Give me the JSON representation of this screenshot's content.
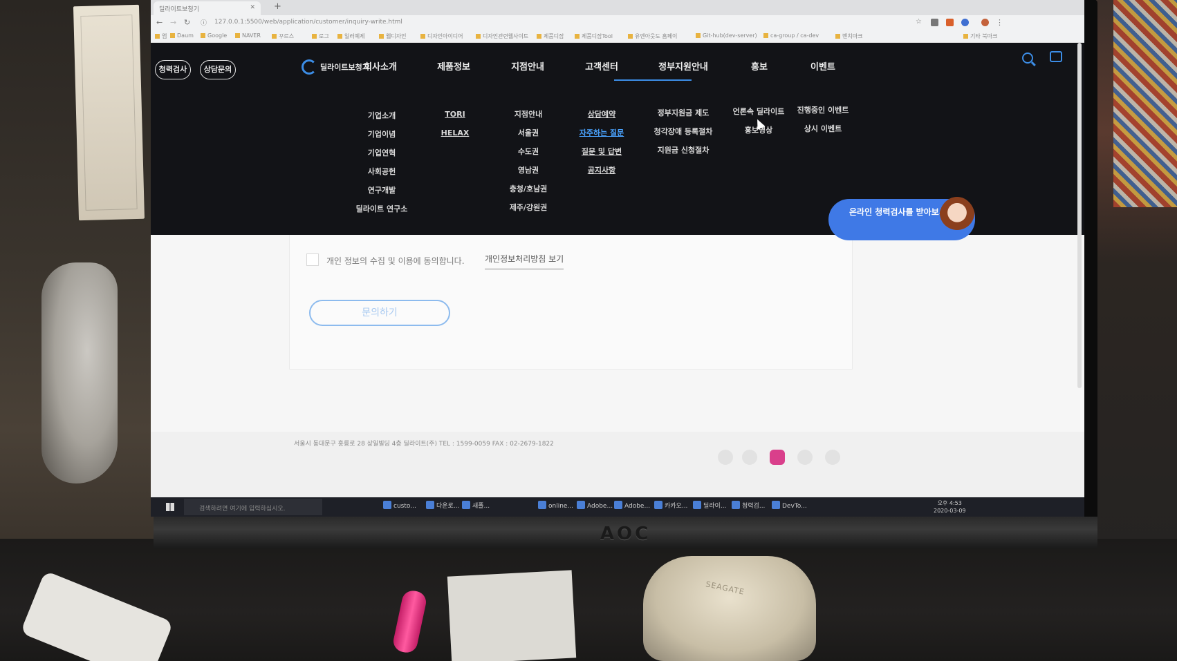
{
  "browser": {
    "tab_title": "딜라이트보청기",
    "url": "127.0.0.1:5500/web/application/customer/inquiry-write.html",
    "bookmarks": [
      "앱",
      "Daum",
      "Google",
      "NAVER",
      "꾸르스",
      "로그",
      "일러예제",
      "웹디자인",
      "디자인아이디어",
      "디자인관련웹사이트",
      "제품디잡",
      "제품디잡Tool",
      "유엔아웃도 홈페이",
      "Git-hub(dev-server)",
      "ca-group / ca-dev",
      "벤치마크",
      "기타 북마크"
    ]
  },
  "site": {
    "pills": [
      "청력검사",
      "상담문의"
    ],
    "logo_text": "딜라이트보청기",
    "menu": [
      {
        "label": "회사소개",
        "items": [
          "기업소개",
          "기업이념",
          "기업연혁",
          "사회공헌",
          "연구개발",
          "딜라이트 연구소"
        ]
      },
      {
        "label": "제품정보",
        "items": [
          "TORI",
          "HELAX"
        ]
      },
      {
        "label": "지점안내",
        "items": [
          "지점안내",
          "서울권",
          "수도권",
          "영남권",
          "충청/호남권",
          "제주/강원권"
        ]
      },
      {
        "label": "고객센터",
        "items": [
          "상담예약",
          "자주하는 질문",
          "질문 및 답변",
          "공지사항"
        ]
      },
      {
        "label": "정부지원안내",
        "items": [
          "정부지원금 제도",
          "청각장애 등록절차",
          "지원금 신청절차"
        ]
      },
      {
        "label": "홍보",
        "items": [
          "언론속 딜라이트",
          "홍보영상"
        ]
      },
      {
        "label": "이벤트",
        "items": [
          "진행중인 이벤트",
          "상시 이벤트"
        ]
      }
    ],
    "active_menu": "고객센터",
    "hovered_item": "자주하는 질문"
  },
  "form": {
    "consent_label": "개인 정보의 수집 및 이용에 동의합니다.",
    "policy_link": "개인정보처리방침 보기",
    "submit_label": "문의하기"
  },
  "bubble": {
    "text": "온라인 청력검사를 받아보세요."
  },
  "footer": {
    "address": "서울시 동대문구 홍릉로 28 상일빌딩 4층 딜라이트(주) TEL : 1599-0059 FAX : 02-2679-1822"
  },
  "taskbar": {
    "search_placeholder": "검색하려면 여기에 입력하십시오.",
    "apps": [
      "custo...",
      "다운로...",
      "새폴...",
      "online...",
      "Adobe...",
      "Adobe...",
      "카카오...",
      "딜라이...",
      "청력검...",
      "DevTo..."
    ],
    "time": "오후 4:53",
    "date": "2020-03-09"
  },
  "monitor": {
    "brand": "AOC"
  },
  "desk": {
    "hdd_label": "SEAGATE"
  },
  "colors": {
    "accent": "#3c8de6",
    "nav_bg": "#121317",
    "bubble": "#3f79e6"
  }
}
